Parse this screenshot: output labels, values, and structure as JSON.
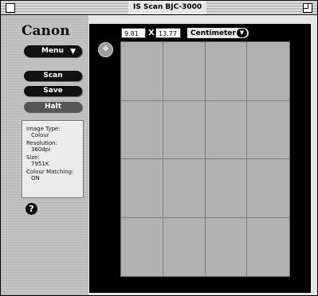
{
  "window": {
    "title": "IS Scan BJC-3000"
  },
  "sidebar": {
    "logo": "Canon",
    "menu_label": "Menu",
    "menu_arrow": "▼",
    "buttons": {
      "scan": "Scan",
      "save": "Save",
      "halt": "Halt"
    },
    "info": {
      "image_type_label": "Image Type:",
      "image_type_value": "Colour",
      "resolution_label": "Resolution:",
      "resolution_value": "360dpi",
      "size_label": "Size:",
      "size_value": "7951K",
      "colour_matching_label": "Colour Matching:",
      "colour_matching_value": "ON"
    },
    "help_label": "?"
  },
  "toolbar": {
    "width": "9.81",
    "x_label": "X",
    "height": "13.77",
    "unit": "Centimeter"
  },
  "preview": {
    "button_glyph": "✥",
    "grid_rows": 4,
    "grid_cols": 4
  },
  "colors": {
    "sidebar_bg": "#c0c0c0",
    "preview_bg": "#000000",
    "scan_area": "#b0b0b0",
    "button_dark": "#111111"
  },
  "icons": {
    "close": "close-box",
    "zoom": "zoom-box",
    "menu_arrow": "triangle-down-icon",
    "unit_arrow": "triangle-down-icon",
    "preview": "move-arrows-icon",
    "help": "question-mark-icon"
  }
}
